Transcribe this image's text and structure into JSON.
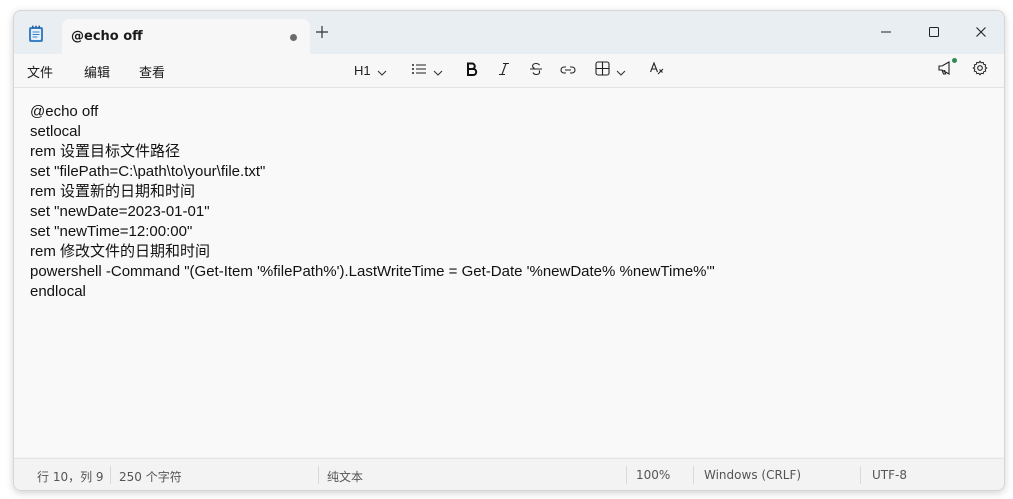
{
  "window": {
    "tab_title": "@echo off"
  },
  "menu": {
    "file": "文件",
    "edit": "编辑",
    "view": "查看"
  },
  "toolbar": {
    "heading": "H1"
  },
  "icons": {
    "app": "notepad-icon",
    "new_tab": "plus-icon",
    "minimize": "minimize-icon",
    "maximize": "maximize-icon",
    "close": "close-icon",
    "heading_dropdown": "chevron-down-icon",
    "list": "list-icon",
    "bold": "bold-icon",
    "italic": "italic-icon",
    "strikethrough": "strikethrough-icon",
    "link": "link-icon",
    "table": "table-icon",
    "clear_format": "clear-formatting-icon",
    "feedback": "megaphone-icon",
    "settings": "gear-icon"
  },
  "editor": {
    "lines": [
      "@echo off",
      "setlocal",
      "rem 设置目标文件路径",
      "set \"filePath=C:\\path\\to\\your\\file.txt\"",
      "rem 设置新的日期和时间",
      "set \"newDate=2023-01-01\"",
      "set \"newTime=12:00:00\"",
      "rem 修改文件的日期和时间",
      "powershell -Command \"(Get-Item '%filePath%').LastWriteTime = Get-Date '%newDate% %newTime%'\"",
      "endlocal"
    ]
  },
  "status": {
    "position": "行 10，列 9",
    "char_count": "250 个字符",
    "format": "纯文本",
    "zoom": "100%",
    "line_ending": "Windows (CRLF)",
    "encoding": "UTF-8"
  },
  "colors": {
    "titlebar": "#e9eef3",
    "toolbar": "#f7f7f7",
    "editor_bg": "#f9f9f9",
    "statusbar": "#f3f3f3",
    "notification_dot": "#2e8b57"
  }
}
